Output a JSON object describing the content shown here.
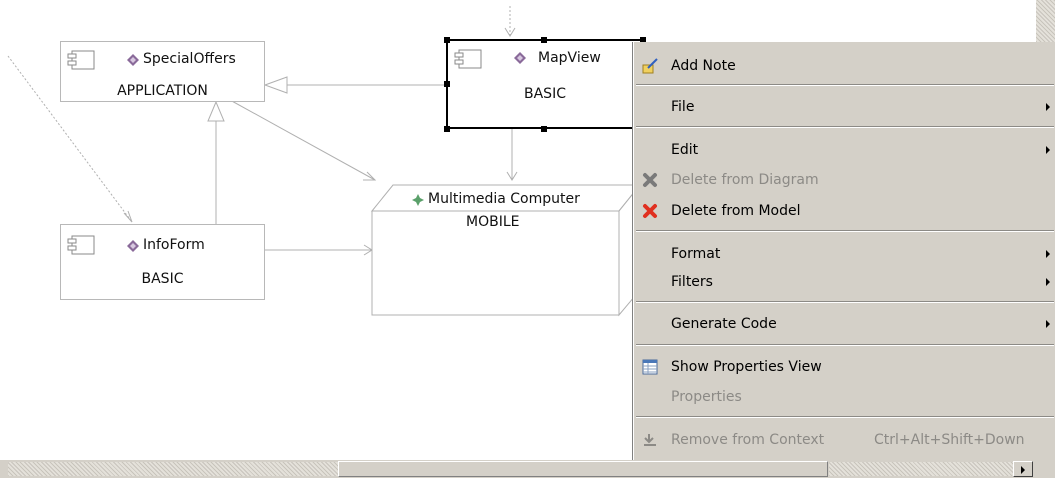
{
  "diagram": {
    "special_offers": {
      "name": "SpecialOffers",
      "stereotype": "APPLICATION"
    },
    "map_view": {
      "name": "MapView",
      "stereotype": "BASIC"
    },
    "info_form": {
      "name": "InfoForm",
      "stereotype": "BASIC"
    },
    "multimedia_computer": {
      "name": "Multimedia Computer",
      "stereotype": "MOBILE"
    }
  },
  "context_menu": {
    "add_note": "Add Note",
    "file": "File",
    "edit": "Edit",
    "delete_from_diagram": "Delete from Diagram",
    "delete_from_model": "Delete from Model",
    "format": "Format",
    "filters": "Filters",
    "generate_code": "Generate Code",
    "show_properties_view": "Show Properties View",
    "properties": "Properties",
    "remove_from_context": "Remove from Context",
    "remove_from_context_shortcut": "Ctrl+Alt+Shift+Down"
  },
  "icons": {
    "component": "component-icon",
    "element_diamond": "diamond-icon",
    "node_star": "node-icon",
    "note": "add-note-icon",
    "delete": "delete-icon",
    "properties": "properties-table-icon",
    "remove": "remove-from-context-icon"
  },
  "colors": {
    "menu_bg": "#d4d0c8",
    "diamond": "#8a6a9a",
    "node_star": "#5aa06a",
    "delete_red": "#e03020"
  }
}
